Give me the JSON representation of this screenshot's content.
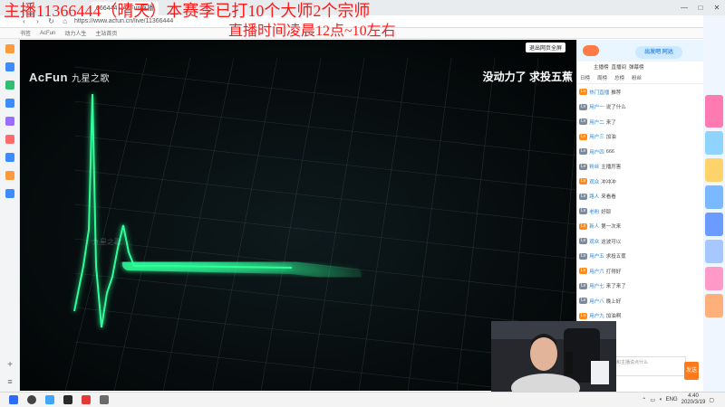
{
  "overlay": {
    "line1": "主播11366444（晴天）本赛季已打10个大师2个宗师",
    "line2": "直播时间凌晨12点~10左右"
  },
  "browser": {
    "tab_title": "666444 - AcFun直播",
    "address": "https://www.acfun.cn/live/11366444",
    "bookmarks": [
      "书签",
      "AcFun",
      "动力人生",
      "主站首页"
    ]
  },
  "video": {
    "logo": "AcFun",
    "logo_sub": "九星之歌",
    "title": "没动力了 求投五蕉",
    "exit_button": "退出网页全屏",
    "watermark": "九星之歌",
    "ecg_color": "#2dff9a"
  },
  "chat": {
    "banner_title": "出发吧 阿达",
    "tabs_row1": [
      "主播榜",
      "直播间",
      "弹幕榜"
    ],
    "tabs_row2": [
      "日榜",
      "周榜",
      "总榜",
      "粉丝"
    ],
    "lines": [
      {
        "name": "热门直播",
        "text": "推荐"
      },
      {
        "name": "用户一",
        "text": "说了什么"
      },
      {
        "name": "用户二",
        "text": "来了"
      },
      {
        "name": "用户三",
        "text": "加油"
      },
      {
        "name": "用户四",
        "text": "666"
      },
      {
        "name": "粉丝",
        "text": "主播厉害"
      },
      {
        "name": "观众",
        "text": "冲冲冲"
      },
      {
        "name": "路人",
        "text": "来看看"
      },
      {
        "name": "老粉",
        "text": "好耶"
      },
      {
        "name": "新人",
        "text": "第一次来"
      },
      {
        "name": "观众",
        "text": "这波可以"
      },
      {
        "name": "用户五",
        "text": "求投五蕉"
      },
      {
        "name": "用户六",
        "text": "打得好"
      },
      {
        "name": "用户七",
        "text": "来了来了"
      },
      {
        "name": "用户八",
        "text": "晚上好"
      },
      {
        "name": "用户九",
        "text": "加油啊"
      },
      {
        "name": "用户十",
        "text": "厉害"
      },
      {
        "name": "用户",
        "text": "冲"
      }
    ],
    "input_placeholder": "和主播说点什么",
    "send_label": "发送"
  },
  "taskbar": {
    "lang": "ENG",
    "time": "4:40",
    "date": "2020/3/19"
  },
  "window_controls": [
    "—",
    "□",
    "✕"
  ]
}
